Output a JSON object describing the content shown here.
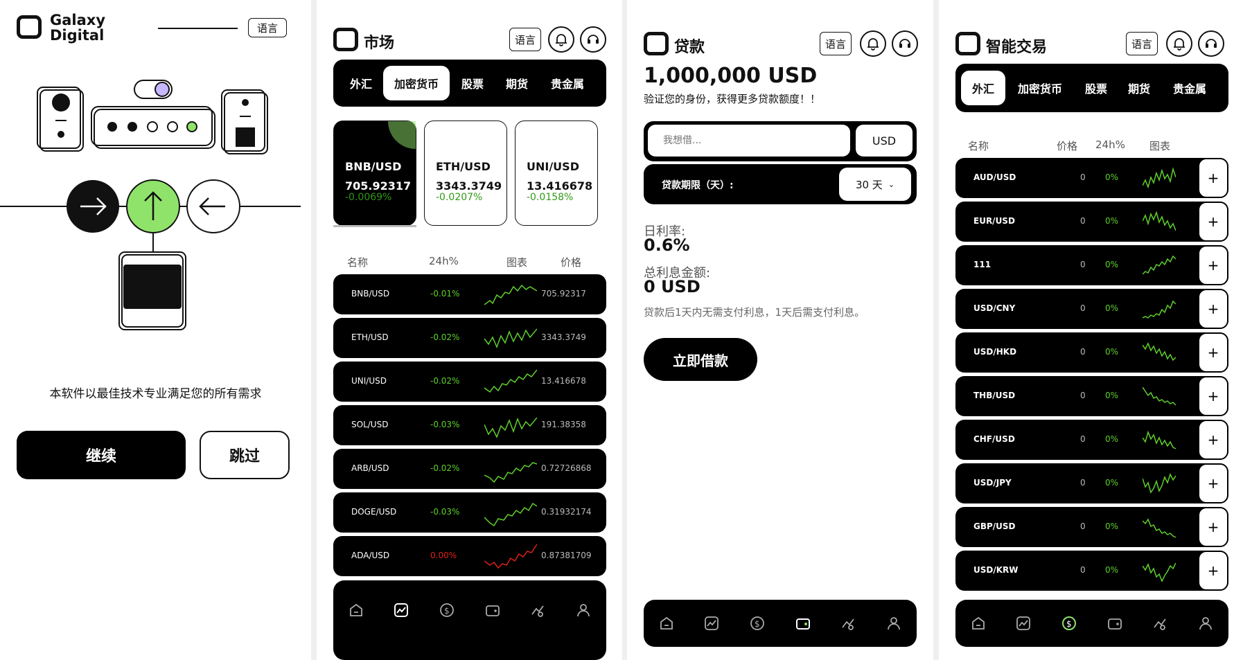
{
  "p1": {
    "brand_line1": "Galaxy",
    "brand_line2": "Digital",
    "lang": "语言",
    "tagline": "本软件以最佳技术专业满足您的所有需求",
    "continue": "继续",
    "skip": "跳过"
  },
  "p2": {
    "title": "市场",
    "lang": "语言",
    "tabs": [
      "外汇",
      "加密货币",
      "股票",
      "期货",
      "贵金属"
    ],
    "cards": [
      {
        "pair": "BNB/USD",
        "price": "705.92317",
        "change": "-0.0069%"
      },
      {
        "pair": "ETH/USD",
        "price": "3343.3749",
        "change": "-0.0207%"
      },
      {
        "pair": "UNI/USD",
        "price": "13.416678",
        "change": "-0.0158%"
      }
    ],
    "headers": {
      "name": "名称",
      "change": "24h%",
      "chart": "图表",
      "price": "价格"
    },
    "rows": [
      {
        "name": "BNB/USD",
        "change": "-0.01%",
        "price": "705.92317"
      },
      {
        "name": "ETH/USD",
        "change": "-0.02%",
        "price": "3343.3749"
      },
      {
        "name": "UNI/USD",
        "change": "-0.02%",
        "price": "13.416678"
      },
      {
        "name": "SOL/USD",
        "change": "-0.03%",
        "price": "191.38358"
      },
      {
        "name": "ARB/USD",
        "change": "-0.02%",
        "price": "0.72726868"
      },
      {
        "name": "DOGE/USD",
        "change": "-0.03%",
        "price": "0.31932174"
      },
      {
        "name": "ADA/USD",
        "change": "0.00%",
        "price": "0.87381709"
      }
    ]
  },
  "p3": {
    "title": "贷款",
    "lang": "语言",
    "amount": "1,000,000 USD",
    "verify": "验证您的身份，获得更多贷款额度！！",
    "input_placeholder": "我想借...",
    "currency": "USD",
    "term_label": "贷款期限（天）:",
    "term_value": "30 天",
    "daily_rate_label": "日利率:",
    "daily_rate": "0.6%",
    "total_interest_label": "总利息金额:",
    "total_interest": "0 USD",
    "note": "贷款后1天内无需支付利息，1天后需支付利息。",
    "borrow_btn": "立即借款"
  },
  "p4": {
    "title": "智能交易",
    "lang": "语言",
    "tabs": [
      "外汇",
      "加密货币",
      "股票",
      "期货",
      "贵金属"
    ],
    "headers": {
      "name": "名称",
      "price": "价格",
      "change": "24h%",
      "chart": "图表"
    },
    "rows": [
      {
        "name": "AUD/USD",
        "price": "0",
        "change": "0%"
      },
      {
        "name": "EUR/USD",
        "price": "0",
        "change": "0%"
      },
      {
        "name": "111",
        "price": "0",
        "change": "0%"
      },
      {
        "name": "USD/CNY",
        "price": "0",
        "change": "0%"
      },
      {
        "name": "USD/HKD",
        "price": "0",
        "change": "0%"
      },
      {
        "name": "THB/USD",
        "price": "0",
        "change": "0%"
      },
      {
        "name": "CHF/USD",
        "price": "0",
        "change": "0%"
      },
      {
        "name": "USD/JPY",
        "price": "0",
        "change": "0%"
      },
      {
        "name": "GBP/USD",
        "price": "0",
        "change": "0%"
      },
      {
        "name": "USD/KRW",
        "price": "0",
        "change": "0%"
      }
    ],
    "plus": "+"
  },
  "colors": {
    "accent_green": "#8fe36a",
    "up_green": "#5fd02c",
    "down_red": "#e0201a"
  }
}
